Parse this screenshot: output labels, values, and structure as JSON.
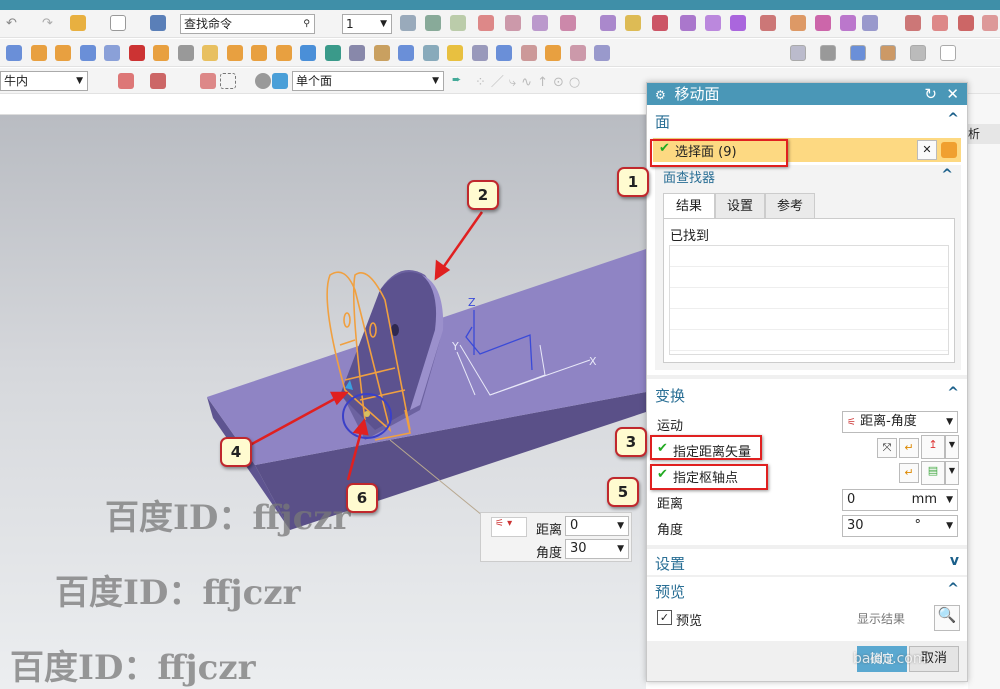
{
  "toolbar": {
    "search_placeholder": "查找命令",
    "layer_value": "1",
    "filter_left": "牛内",
    "face_rule": "单个面"
  },
  "viewport": {
    "watermark": "百度ID：ffjczr",
    "axis_x": "X",
    "axis_y": "Y",
    "axis_z": "Z",
    "onscreen": {
      "distance_label": "距离",
      "distance_value": "0",
      "angle_label": "角度",
      "angle_value": "30"
    }
  },
  "callouts": [
    "1",
    "2",
    "3",
    "4",
    "5",
    "6"
  ],
  "right_panel": {
    "header_fragment": "析"
  },
  "dialog": {
    "title": "移动面",
    "face_section": "面",
    "select_face": "选择面 (9)",
    "face_finder": "面查找器",
    "tabs": [
      "结果",
      "设置",
      "参考"
    ],
    "found_label": "已找到",
    "transform_section": "变换",
    "motion_label": "运动",
    "motion_value": "距离-角度",
    "distance_vector": "指定距离矢量",
    "pivot_point": "指定枢轴点",
    "distance_label": "距离",
    "distance_value": "0",
    "distance_unit": "mm",
    "angle_label": "角度",
    "angle_value": "30",
    "angle_unit": "°",
    "settings_section": "设置",
    "preview_section": "预览",
    "preview_checkbox": "预览",
    "preview_checked": true,
    "show_result": "显示结果",
    "ok": "确定",
    "cancel": "取消",
    "ok_overlay": "baidu.com"
  },
  "colors": {
    "title_bar": "#4a97b7",
    "selection": "#fdd982",
    "highlight_box": "#e02020",
    "model": "#8a7fc0",
    "wire": "#f0a040"
  }
}
